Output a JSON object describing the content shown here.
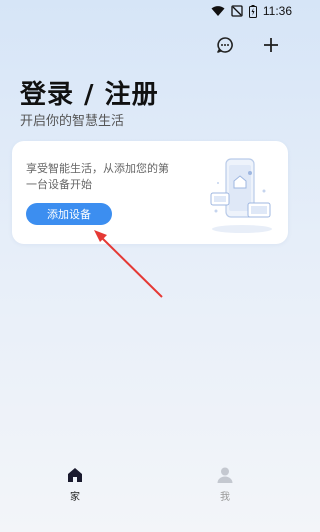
{
  "status_bar": {
    "time": "11:36"
  },
  "header": {
    "title": "登录 / 注册",
    "subtitle": "开启你的智慧生活"
  },
  "card": {
    "text": "享受智能生活，从添加您的第一台设备开始",
    "button_label": "添加设备"
  },
  "bottom_nav": {
    "items": [
      {
        "label": "家",
        "icon": "home-icon",
        "active": true
      },
      {
        "label": "我",
        "icon": "profile-icon",
        "active": false
      }
    ]
  },
  "colors": {
    "accent": "#3c8ef0",
    "annotation_arrow": "#e53935"
  }
}
